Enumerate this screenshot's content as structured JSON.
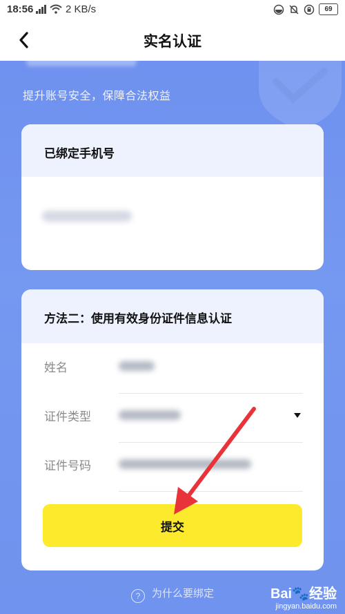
{
  "status_bar": {
    "time": "18:56",
    "speed": "2 KB/s",
    "battery": "69"
  },
  "nav": {
    "title": "实名认证"
  },
  "hero": {
    "subtitle": "提升账号安全，保障合法权益"
  },
  "bound_phone_card": {
    "title": "已绑定手机号"
  },
  "verify_card": {
    "title": "方法二：使用有效身份证件信息认证",
    "fields": [
      {
        "label": "姓名"
      },
      {
        "label": "证件类型"
      },
      {
        "label": "证件号码"
      }
    ],
    "submit_label": "提交"
  },
  "help": {
    "icon_text": "?",
    "text": "为什么要绑定"
  },
  "watermark": {
    "brand": "Bai",
    "brand_suffix": "经验",
    "url": "jingyan.baidu.com"
  },
  "colors": {
    "accent_blue": "#7598f1",
    "card_header": "#edf2fe",
    "submit_yellow": "#fdea2d",
    "arrow_red": "#e8333a"
  }
}
